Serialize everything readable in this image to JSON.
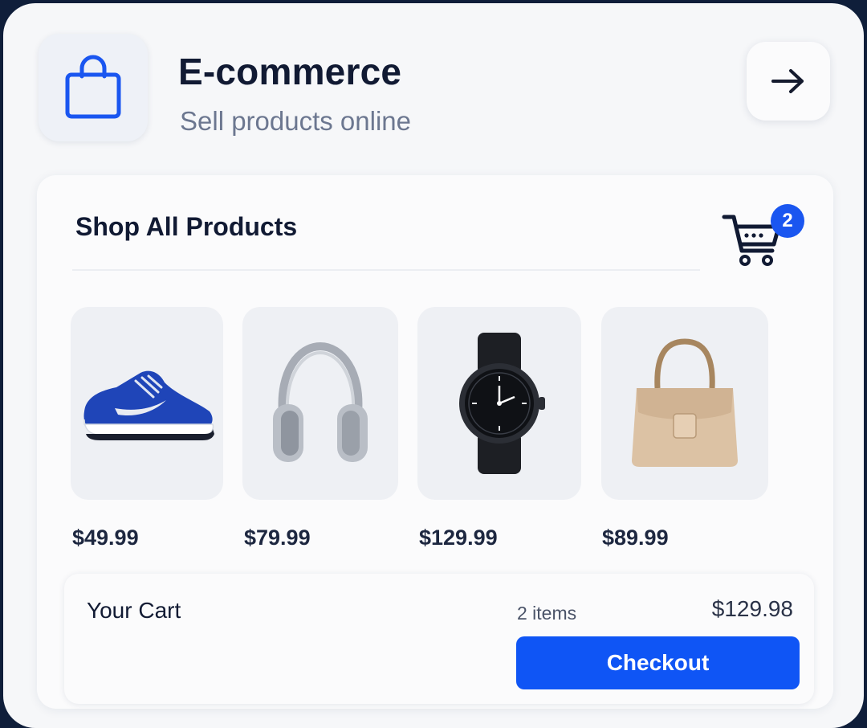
{
  "header": {
    "title": "E-commerce",
    "subtitle": "Sell products online",
    "icon": "shopping-bag-icon",
    "action_icon": "arrow-right-icon"
  },
  "shop": {
    "title": "Shop All Products",
    "cart_icon": "shopping-cart-icon",
    "cart_badge": "2",
    "products": [
      {
        "icon": "sneaker-image",
        "price": "$49.99"
      },
      {
        "icon": "headphones-image",
        "price": "$79.99"
      },
      {
        "icon": "smartwatch-image",
        "price": "$129.99"
      },
      {
        "icon": "handbag-image",
        "price": "$89.99"
      }
    ]
  },
  "cart": {
    "title": "Your Cart",
    "count": "2 items",
    "total": "$129.98",
    "checkout_label": "Checkout"
  },
  "colors": {
    "accent": "#0f55f5",
    "title_text": "#111a33",
    "subtitle_text": "#6c7790",
    "panel_bg": "#fbfbfc",
    "tile_bg": "#eef0f4"
  }
}
